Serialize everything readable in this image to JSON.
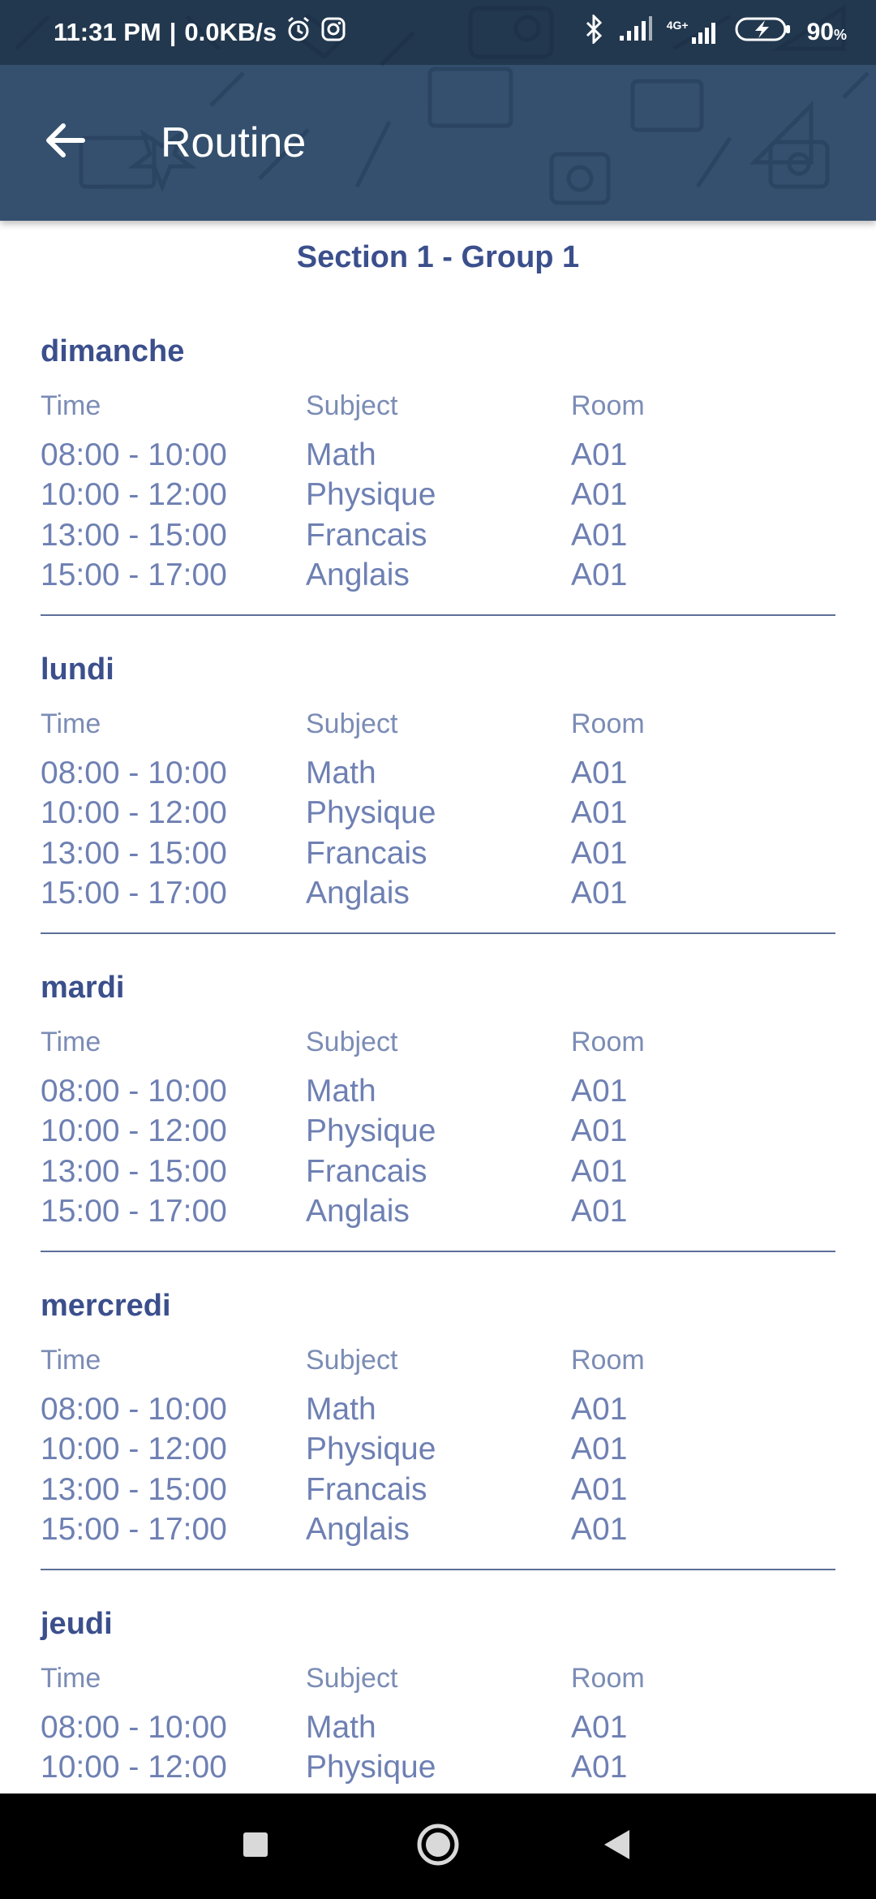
{
  "status_bar": {
    "time": "11:31 PM",
    "separator": "|",
    "speed": "0.0KB/s",
    "battery": "90",
    "battery_unit": "%",
    "network_label": "4G+",
    "icons": [
      "alarm-icon",
      "instagram-icon",
      "bluetooth-icon",
      "signal-icon",
      "signal-4g-icon",
      "battery-charging-icon"
    ]
  },
  "toolbar": {
    "title": "Routine",
    "back_icon": "arrow-left-icon"
  },
  "section_title": "Section 1 - Group 1",
  "columns": {
    "time": "Time",
    "subject": "Subject",
    "room": "Room"
  },
  "days": [
    {
      "name": "dimanche",
      "rows": [
        {
          "time": "08:00 - 10:00",
          "subject": "Math",
          "room": "A01"
        },
        {
          "time": "10:00 - 12:00",
          "subject": "Physique",
          "room": "A01"
        },
        {
          "time": "13:00 - 15:00",
          "subject": "Francais",
          "room": "A01"
        },
        {
          "time": "15:00 - 17:00",
          "subject": "Anglais",
          "room": "A01"
        }
      ]
    },
    {
      "name": "lundi",
      "rows": [
        {
          "time": "08:00 - 10:00",
          "subject": "Math",
          "room": "A01"
        },
        {
          "time": "10:00 - 12:00",
          "subject": "Physique",
          "room": "A01"
        },
        {
          "time": "13:00 - 15:00",
          "subject": "Francais",
          "room": "A01"
        },
        {
          "time": "15:00 - 17:00",
          "subject": "Anglais",
          "room": "A01"
        }
      ]
    },
    {
      "name": "mardi",
      "rows": [
        {
          "time": "08:00 - 10:00",
          "subject": "Math",
          "room": "A01"
        },
        {
          "time": "10:00 - 12:00",
          "subject": "Physique",
          "room": "A01"
        },
        {
          "time": "13:00 - 15:00",
          "subject": "Francais",
          "room": "A01"
        },
        {
          "time": "15:00 - 17:00",
          "subject": "Anglais",
          "room": "A01"
        }
      ]
    },
    {
      "name": "mercredi",
      "rows": [
        {
          "time": "08:00 - 10:00",
          "subject": "Math",
          "room": "A01"
        },
        {
          "time": "10:00 - 12:00",
          "subject": "Physique",
          "room": "A01"
        },
        {
          "time": "13:00 - 15:00",
          "subject": "Francais",
          "room": "A01"
        },
        {
          "time": "15:00 - 17:00",
          "subject": "Anglais",
          "room": "A01"
        }
      ]
    },
    {
      "name": "jeudi",
      "rows": [
        {
          "time": "08:00 - 10:00",
          "subject": "Math",
          "room": "A01"
        },
        {
          "time": "10:00 - 12:00",
          "subject": "Physique",
          "room": "A01"
        }
      ]
    }
  ],
  "nav_bar": {
    "icons": [
      "recent-apps-icon",
      "home-icon",
      "back-icon"
    ]
  },
  "colors": {
    "header": "#34506e",
    "accent_text": "#3b4f8c",
    "body_text": "#6e80b3",
    "nav_bar": "#000000"
  }
}
